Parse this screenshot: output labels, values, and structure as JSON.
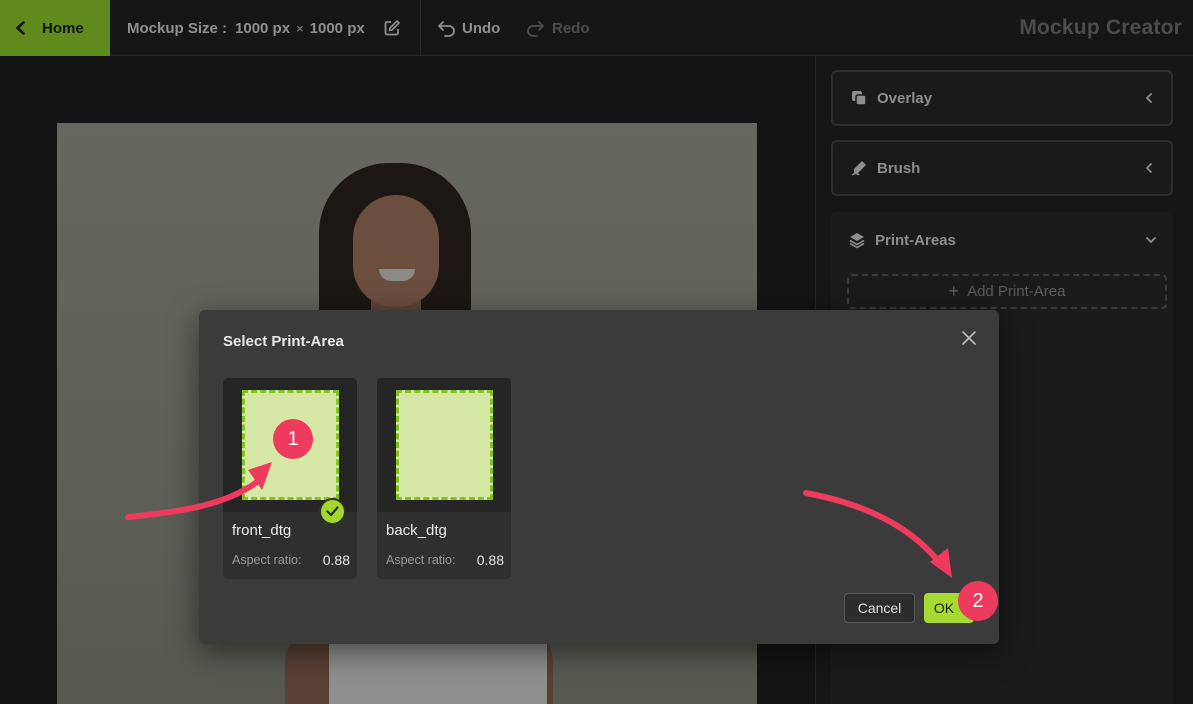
{
  "topbar": {
    "home_label": "Home",
    "mockup_size_label": "Mockup Size :",
    "width": "1000 px",
    "times": "×",
    "height": "1000 px",
    "undo_label": "Undo",
    "redo_label": "Redo",
    "app_title": "Mockup Creator"
  },
  "panel": {
    "overlay_label": "Overlay",
    "brush_label": "Brush",
    "print_areas_label": "Print-Areas",
    "add_print_area_label": "Add Print-Area"
  },
  "dialog": {
    "title": "Select Print-Area",
    "cards": [
      {
        "name": "front_dtg",
        "aspect_label": "Aspect ratio:",
        "aspect_value": "0.88",
        "selected": true
      },
      {
        "name": "back_dtg",
        "aspect_label": "Aspect ratio:",
        "aspect_value": "0.88",
        "selected": false
      }
    ],
    "cancel_label": "Cancel",
    "ok_label": "OK"
  },
  "annotations": {
    "step1": "1",
    "step2": "2",
    "color": "#ec3b5d"
  },
  "colors": {
    "accent": "#a6d931",
    "home_bg": "#5f8a1c",
    "print_area_fill": "#d6e7a6",
    "print_area_border": "#7fc31c"
  }
}
